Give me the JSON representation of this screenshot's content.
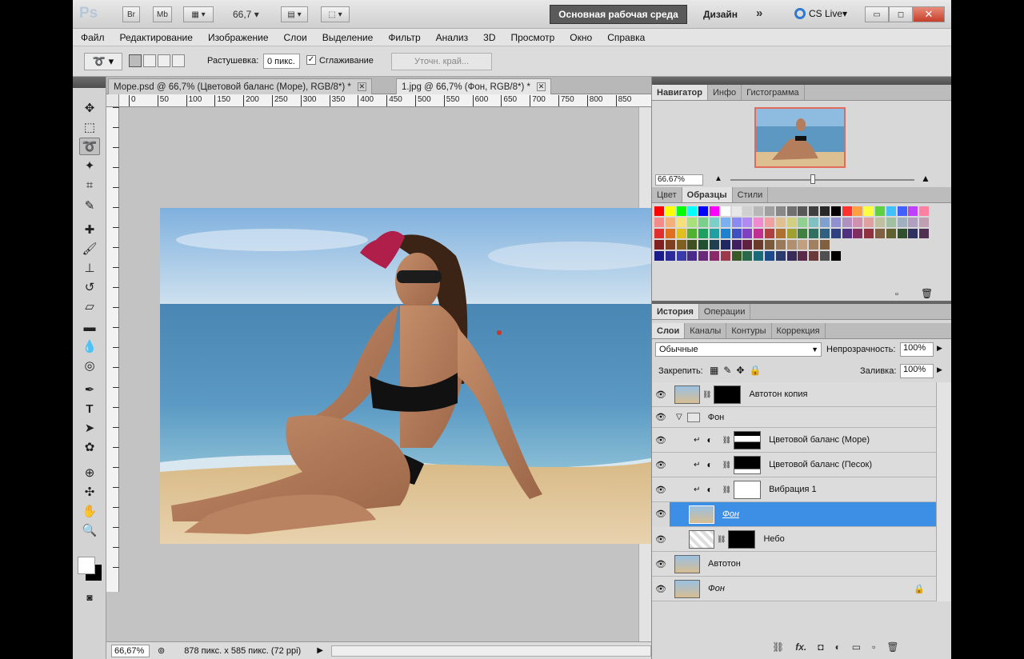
{
  "app": {
    "logo": "Ps",
    "title_buttons": [
      "Br",
      "Mb"
    ],
    "zoom_value": "66,7",
    "workspace_label": "Основная рабочая среда",
    "design_label": "Дизайн",
    "more_label": "»",
    "cslive_label": "CS Live"
  },
  "menu": [
    "Файл",
    "Редактирование",
    "Изображение",
    "Слои",
    "Выделение",
    "Фильтр",
    "Анализ",
    "3D",
    "Просмотр",
    "Окно",
    "Справка"
  ],
  "options": {
    "feather_label": "Растушевка:",
    "feather_value": "0 пикс.",
    "antialias_label": "Сглаживание",
    "refine_label": "Уточн. край..."
  },
  "documents": {
    "tabs": [
      {
        "label": "Море.psd @ 66,7% (Цветовой баланс  (Море), RGB/8*) *",
        "active": false
      },
      {
        "label": "1.jpg @ 66,7% (Фон, RGB/8*) *",
        "active": true
      }
    ],
    "ruler_ticks": [
      "0",
      "50",
      "100",
      "150",
      "200",
      "250",
      "300",
      "350",
      "400",
      "450",
      "500",
      "550",
      "600",
      "650",
      "700",
      "750",
      "800",
      "850"
    ],
    "status_zoom": "66,67%",
    "status_info": "878 пикс. x 585 пикс. (72 ppi)"
  },
  "navigator": {
    "tabs": [
      "Навигатор",
      "Инфо",
      "Гистограмма"
    ],
    "zoom": "66.67%"
  },
  "swatches_panel": {
    "tabs": [
      "Цвет",
      "Образцы",
      "Стили"
    ]
  },
  "history_panel": {
    "tabs": [
      "История",
      "Операции"
    ]
  },
  "layers_panel": {
    "tabs": [
      "Слои",
      "Каналы",
      "Контуры",
      "Коррекция"
    ],
    "blend_mode": "Обычные",
    "opacity_label": "Непрозрачность:",
    "opacity_value": "100%",
    "lock_label": "Закрепить:",
    "fill_label": "Заливка:",
    "fill_value": "100%",
    "layers": [
      {
        "name": "Автотон копия",
        "kind": "photo+mask",
        "selected": false
      },
      {
        "name": "Фон",
        "kind": "group",
        "selected": false
      },
      {
        "name": "Цветовой баланс (Море)",
        "kind": "adjust",
        "selected": false
      },
      {
        "name": "Цветовой баланс (Песок)",
        "kind": "adjust",
        "selected": false
      },
      {
        "name": "Вибрация 1",
        "kind": "adjust",
        "selected": false
      },
      {
        "name": "Фон",
        "kind": "photo",
        "selected": true
      },
      {
        "name": "Небо",
        "kind": "sky+mask",
        "selected": false
      },
      {
        "name": "Автотон",
        "kind": "photo",
        "selected": false
      },
      {
        "name": "Фон",
        "kind": "photo-locked",
        "selected": false
      }
    ]
  }
}
